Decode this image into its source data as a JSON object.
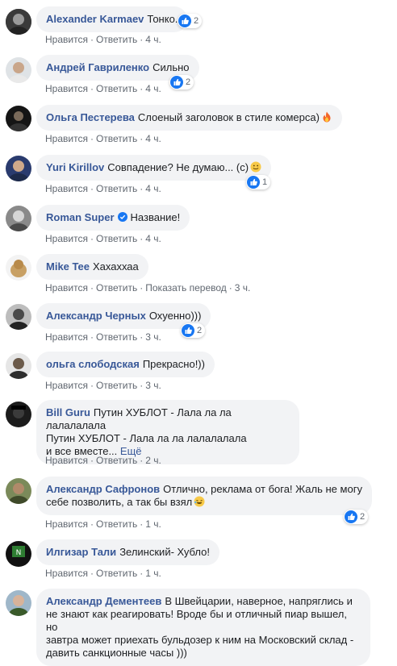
{
  "action_labels": {
    "like": "Нравится",
    "reply": "Ответить",
    "translate": "Показать перевод"
  },
  "comments": [
    {
      "name": "Alexander Karmaev",
      "text": "Тонко.",
      "time": "4 ч.",
      "reactions": "2"
    },
    {
      "name": "Андрей Гавриленко",
      "text": "Сильно",
      "time": "4 ч.",
      "reactions": "2"
    },
    {
      "name": "Ольга Пестерева",
      "text": "Слоеный заголовок в стиле комерса)",
      "time": "4 ч.",
      "emoji": "fire-emoji"
    },
    {
      "name": "Yuri Kirillov",
      "text": "Совпадение? Не думаю... (с)",
      "time": "4 ч.",
      "emoji": "smile-emoji",
      "reactions": "1"
    },
    {
      "name": "Roman Super",
      "text": "Название!",
      "time": "4 ч.",
      "verified": true
    },
    {
      "name": "Mike Tee",
      "text": "Хахаххаа",
      "time": "3 ч."
    },
    {
      "name": "Александр Черных",
      "text": "Охуенно)))",
      "time": "3 ч.",
      "reactions": "2"
    },
    {
      "name": "ольга слободская",
      "text": "Прекрасно!))",
      "time": "3 ч."
    },
    {
      "name": "Bill Guru",
      "text_lines": [
        "Путин ХУБЛОТ - Лала ла ла лалалалала",
        "Путин ХУБЛОТ - Лала ла ла лалалалала",
        "и все вместе..."
      ],
      "more": "Ещё",
      "time": "2 ч."
    },
    {
      "name": "Александр Сафронов",
      "text_lines": [
        "Отлично, реклама от бога! Жаль не могу",
        "себе позволить, а так бы взял"
      ],
      "time": "1 ч.",
      "emoji": "laughing-emoji",
      "reactions": "2"
    },
    {
      "name": "Илгизар Тали",
      "text": "Зелинский- Хубло!",
      "time": "1 ч."
    },
    {
      "name": "Александр Дементеев",
      "text_lines": [
        "В Швейцарии, наверное, напряглись и",
        "не знают как реагировать! Вроде бы и отличный пиар вышел, но",
        "завтра может приехать бульдозер к ним на Московский склад -",
        "давить санкционные часы )))"
      ]
    }
  ],
  "colors": {
    "name": "#385898",
    "bubble": "#f2f3f5",
    "meta": "#606770",
    "like": "#1877f2"
  }
}
